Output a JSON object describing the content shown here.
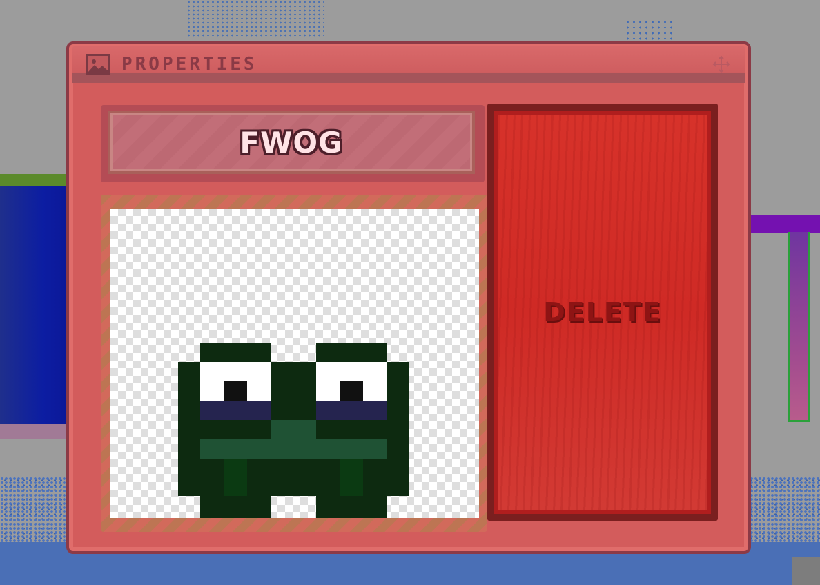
{
  "window": {
    "title": "PROPERTIES"
  },
  "item": {
    "name": "FWOG"
  },
  "actions": {
    "delete_label": "DELETE"
  },
  "icons": {
    "title": "image-icon",
    "move": "move-icon"
  },
  "colors": {
    "window_bg": "#d35c5c",
    "window_border": "#8c3a46",
    "delete_button": "#d7322a",
    "delete_text": "#8e1414",
    "frog_dark": "#0d2a10",
    "frog_mid": "#1f5234"
  }
}
